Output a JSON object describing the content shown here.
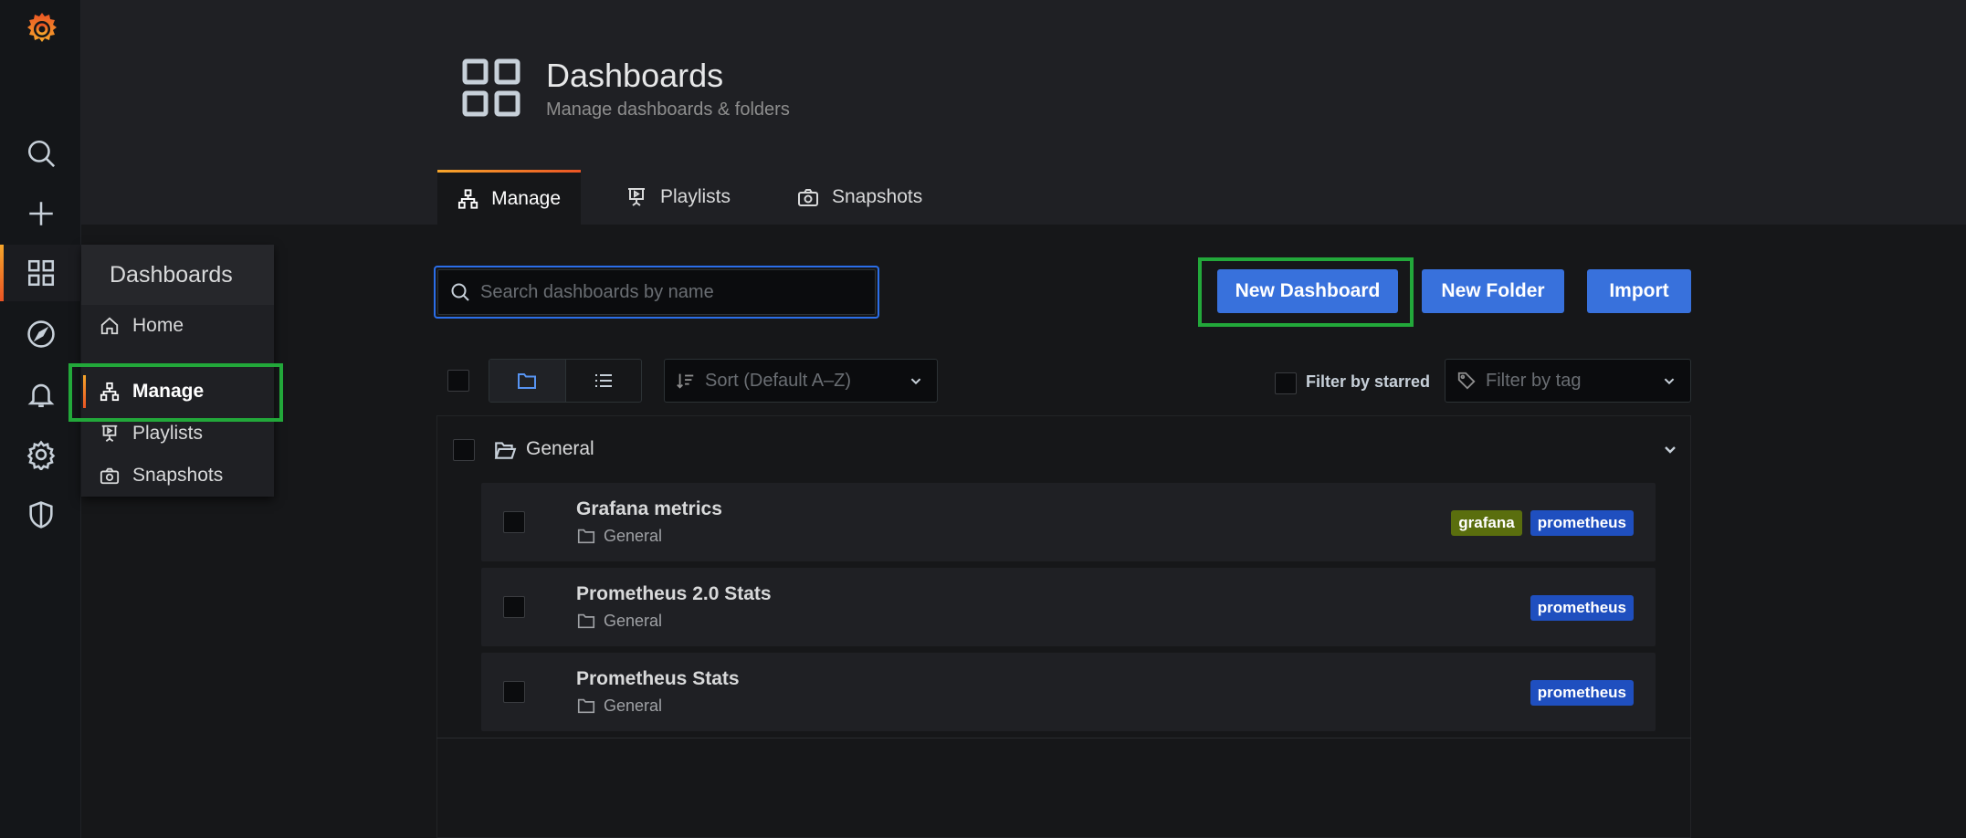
{
  "header": {
    "title": "Dashboards",
    "subtitle": "Manage dashboards & folders"
  },
  "tabs": [
    {
      "label": "Manage",
      "icon": "sitemap-icon",
      "active": true
    },
    {
      "label": "Playlists",
      "icon": "presentation-icon",
      "active": false
    },
    {
      "label": "Snapshots",
      "icon": "camera-icon",
      "active": false
    }
  ],
  "sidenav": {
    "icons": [
      "grafana-logo",
      "search-icon",
      "plus-icon",
      "apps-icon",
      "compass-icon",
      "bell-icon",
      "cog-icon",
      "shield-icon"
    ],
    "active": "apps-icon"
  },
  "flyout": {
    "title": "Dashboards",
    "items": [
      {
        "label": "Home",
        "icon": "home-icon"
      },
      {
        "label": "Manage",
        "icon": "sitemap-icon",
        "active": true
      },
      {
        "label": "Playlists",
        "icon": "presentation-icon"
      },
      {
        "label": "Snapshots",
        "icon": "camera-icon"
      }
    ]
  },
  "toolbar": {
    "search_placeholder": "Search dashboards by name",
    "new_dashboard": "New Dashboard",
    "new_folder": "New Folder",
    "import": "Import"
  },
  "filters": {
    "sort_placeholder": "Sort (Default A–Z)",
    "starred_label": "Filter by starred",
    "tag_placeholder": "Filter by tag"
  },
  "folder": {
    "name": "General"
  },
  "dashboards": [
    {
      "title": "Grafana metrics",
      "folder": "General",
      "tags": [
        "grafana",
        "prometheus"
      ]
    },
    {
      "title": "Prometheus 2.0 Stats",
      "folder": "General",
      "tags": [
        "prometheus"
      ]
    },
    {
      "title": "Prometheus Stats",
      "folder": "General",
      "tags": [
        "prometheus"
      ]
    }
  ],
  "colors": {
    "accent_blue": "#3871dc",
    "highlight_green": "#22a83a",
    "tag_grafana": "#5a6e0e",
    "tag_prometheus": "#1f4fbf",
    "active_gradient_start": "#f6a62b",
    "active_gradient_end": "#eb5424"
  }
}
